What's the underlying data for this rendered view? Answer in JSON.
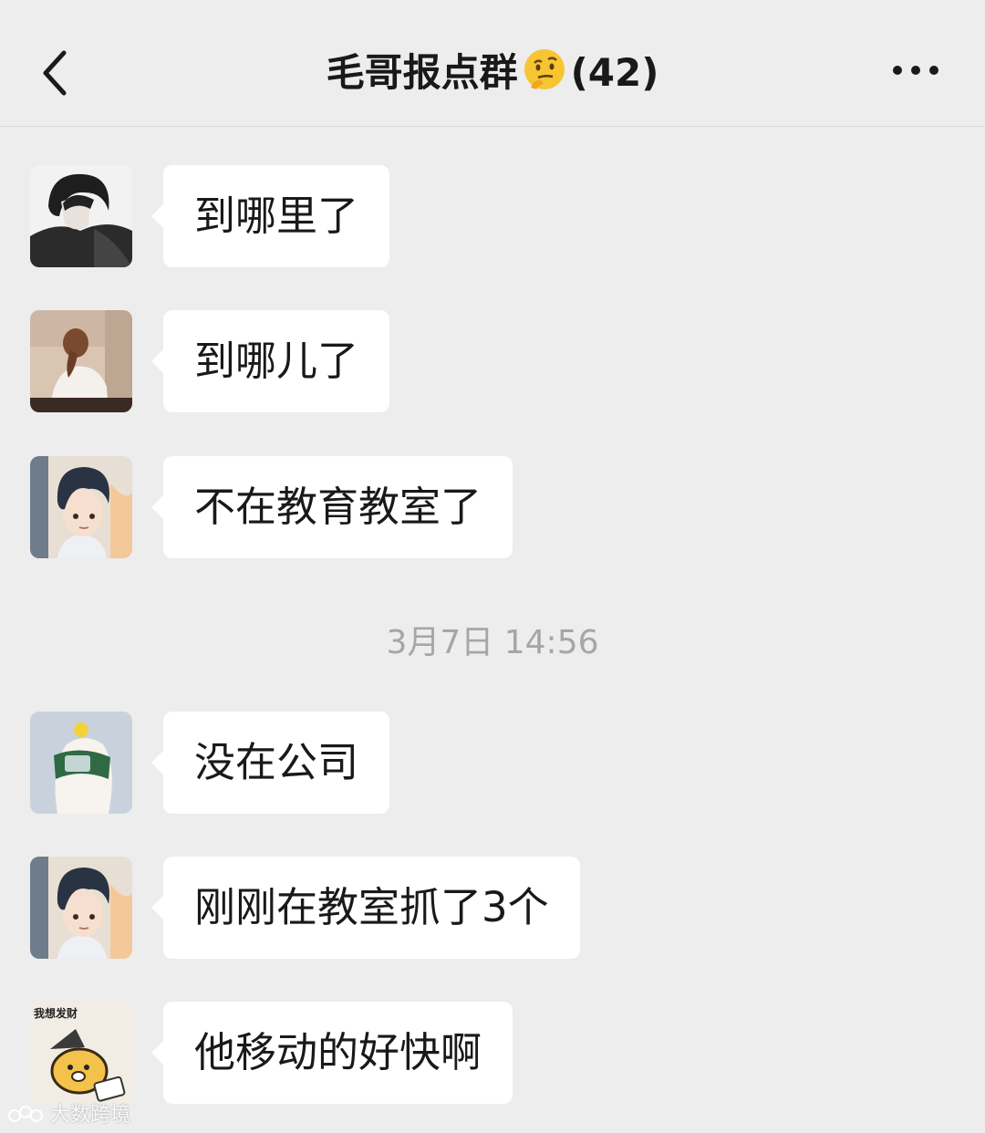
{
  "header": {
    "title": "毛哥报点群",
    "title_emoji": "thinking-face-emoji",
    "member_count": "(42)",
    "back_icon": "chevron-left-icon",
    "more_icon": "ellipsis-icon"
  },
  "messages_before": [
    {
      "avatar": "avatar-dark-hair-man",
      "text": "到哪里了"
    },
    {
      "avatar": "avatar-girl-ponytail",
      "text": "到哪儿了"
    },
    {
      "avatar": "avatar-anime-boy",
      "text": "不在教育教室了"
    }
  ],
  "timestamp": "3月7日 14:56",
  "messages_after": [
    {
      "avatar": "avatar-bottle-dog",
      "text": "没在公司"
    },
    {
      "avatar": "avatar-anime-boy",
      "text": "刚刚在教室抓了3个"
    },
    {
      "avatar": "avatar-bear-sticker",
      "text": "他移动的好快啊",
      "avatar_caption": "我想发财"
    }
  ],
  "watermark": {
    "text": "大数跨境"
  },
  "colors": {
    "background": "#ededed",
    "bubble": "#ffffff",
    "text": "#191919",
    "timestamp": "#a6a6a6"
  }
}
